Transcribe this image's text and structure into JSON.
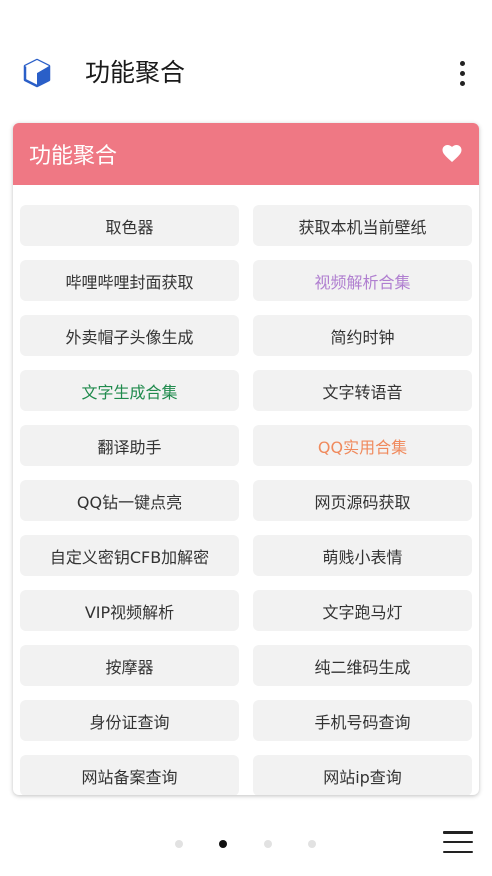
{
  "app_bar": {
    "title": "功能聚合",
    "icon": "cube-icon",
    "menu_icon": "more-vert-icon"
  },
  "card": {
    "title": "功能聚合",
    "header_color": "#ef7884",
    "favorite_icon": "heart-icon"
  },
  "items": [
    {
      "label": "取色器",
      "color": "#333333"
    },
    {
      "label": "获取本机当前壁纸",
      "color": "#333333"
    },
    {
      "label": "哔哩哔哩封面获取",
      "color": "#333333"
    },
    {
      "label": "视频解析合集",
      "color": "#b07fd0"
    },
    {
      "label": "外卖帽子头像生成",
      "color": "#333333"
    },
    {
      "label": "简约时钟",
      "color": "#333333"
    },
    {
      "label": "文字生成合集",
      "color": "#1f8a4c"
    },
    {
      "label": "文字转语音",
      "color": "#333333"
    },
    {
      "label": "翻译助手",
      "color": "#333333"
    },
    {
      "label": "QQ实用合集",
      "color": "#f08a5d"
    },
    {
      "label": "QQ钻一键点亮",
      "color": "#333333"
    },
    {
      "label": "网页源码获取",
      "color": "#333333"
    },
    {
      "label": "自定义密钥CFB加解密",
      "color": "#333333"
    },
    {
      "label": "萌贱小表情",
      "color": "#333333"
    },
    {
      "label": "VIP视频解析",
      "color": "#333333"
    },
    {
      "label": "文字跑马灯",
      "color": "#333333"
    },
    {
      "label": "按摩器",
      "color": "#333333"
    },
    {
      "label": "纯二维码生成",
      "color": "#333333"
    },
    {
      "label": "身份证查询",
      "color": "#333333"
    },
    {
      "label": "手机号码查询",
      "color": "#333333"
    },
    {
      "label": "网站备案查询",
      "color": "#333333"
    },
    {
      "label": "网站ip查询",
      "color": "#333333"
    }
  ],
  "pager": {
    "page_count": 4,
    "active_index": 1,
    "menu_icon": "hamburger-menu-icon"
  }
}
